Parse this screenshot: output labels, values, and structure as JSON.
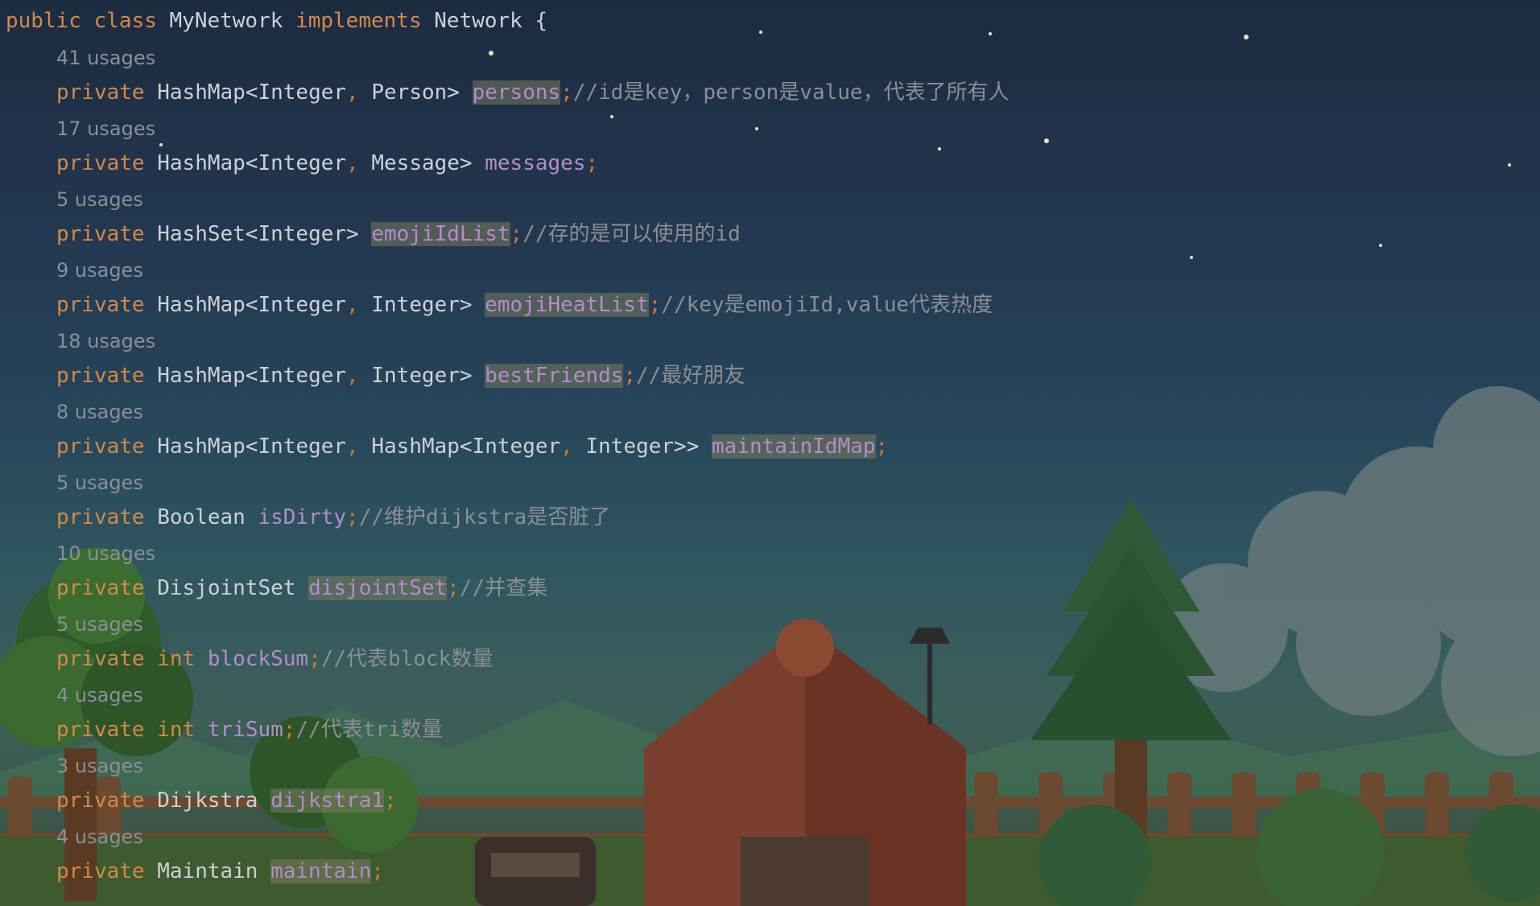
{
  "theme": {
    "keyword_color": "#d3894a",
    "field_color": "#b58bc9",
    "comment_color": "#8a8e95",
    "usage_color": "#8b8f97",
    "highlight_color": "#6f7054"
  },
  "class_decl": {
    "public": "public",
    "class": "class",
    "name": "MyNetwork",
    "implements": "implements",
    "interface": "Network",
    "brace": "{"
  },
  "fields": [
    {
      "usages": "41 usages",
      "modifier": "private",
      "type_a": "HashMap<Integer",
      "comma1": ",",
      "type_b": "Person>",
      "comma2": "",
      "type_c": "",
      "name": "persons",
      "semi": ";",
      "comment": "//id是key，person是value，代表了所有人"
    },
    {
      "usages": "17 usages",
      "modifier": "private",
      "type_a": "HashMap<Integer",
      "comma1": ",",
      "type_b": "Message>",
      "comma2": "",
      "type_c": "",
      "name": "messages",
      "semi": ";",
      "comment": ""
    },
    {
      "usages": "5 usages",
      "modifier": "private",
      "type_a": "HashSet<Integer>",
      "comma1": "",
      "type_b": "",
      "comma2": "",
      "type_c": "",
      "name": "emojiIdList",
      "semi": ";",
      "comment": "//存的是可以使用的id"
    },
    {
      "usages": "9 usages",
      "modifier": "private",
      "type_a": "HashMap<Integer",
      "comma1": ",",
      "type_b": "Integer>",
      "comma2": "",
      "type_c": "",
      "name": "emojiHeatList",
      "semi": ";",
      "comment": "//key是emojiId,value代表热度"
    },
    {
      "usages": "18 usages",
      "modifier": "private",
      "type_a": "HashMap<Integer",
      "comma1": ",",
      "type_b": "Integer>",
      "comma2": "",
      "type_c": "",
      "name": "bestFriends",
      "semi": ";",
      "comment": "//最好朋友"
    },
    {
      "usages": "8 usages",
      "modifier": "private",
      "type_a": "HashMap<Integer",
      "comma1": ",",
      "type_b": "HashMap<Integer",
      "comma2": ",",
      "type_c": "Integer>>",
      "name": "maintainIdMap",
      "semi": ";",
      "comment": ""
    },
    {
      "usages": "5 usages",
      "modifier": "private",
      "type_a": "Boolean",
      "comma1": "",
      "type_b": "",
      "comma2": "",
      "type_c": "",
      "name": "isDirty",
      "semi": ";",
      "comment": "//维护dijkstra是否脏了"
    },
    {
      "usages": "10 usages",
      "modifier": "private",
      "type_a": "DisjointSet",
      "comma1": "",
      "type_b": "",
      "comma2": "",
      "type_c": "",
      "name": "disjointSet",
      "semi": ";",
      "comment": "//并查集"
    },
    {
      "usages": "5 usages",
      "modifier": "private",
      "type_a": "int",
      "comma1": "",
      "type_b": "",
      "comma2": "",
      "type_c": "",
      "name": "blockSum",
      "semi": ";",
      "comment": "//代表block数量"
    },
    {
      "usages": "4 usages",
      "modifier": "private",
      "type_a": "int",
      "comma1": "",
      "type_b": "",
      "comma2": "",
      "type_c": "",
      "name": "triSum",
      "semi": ";",
      "comment": "//代表tri数量"
    },
    {
      "usages": "3 usages",
      "modifier": "private",
      "type_a": "Dijkstra",
      "comma1": "",
      "type_b": "",
      "comma2": "",
      "type_c": "",
      "name": "dijkstra1",
      "semi": ";",
      "comment": ""
    },
    {
      "usages": "4 usages",
      "modifier": "private",
      "type_a": "Maintain",
      "comma1": "",
      "type_b": "",
      "comma2": "",
      "type_c": "",
      "name": "maintain",
      "semi": ";",
      "comment": ""
    }
  ]
}
